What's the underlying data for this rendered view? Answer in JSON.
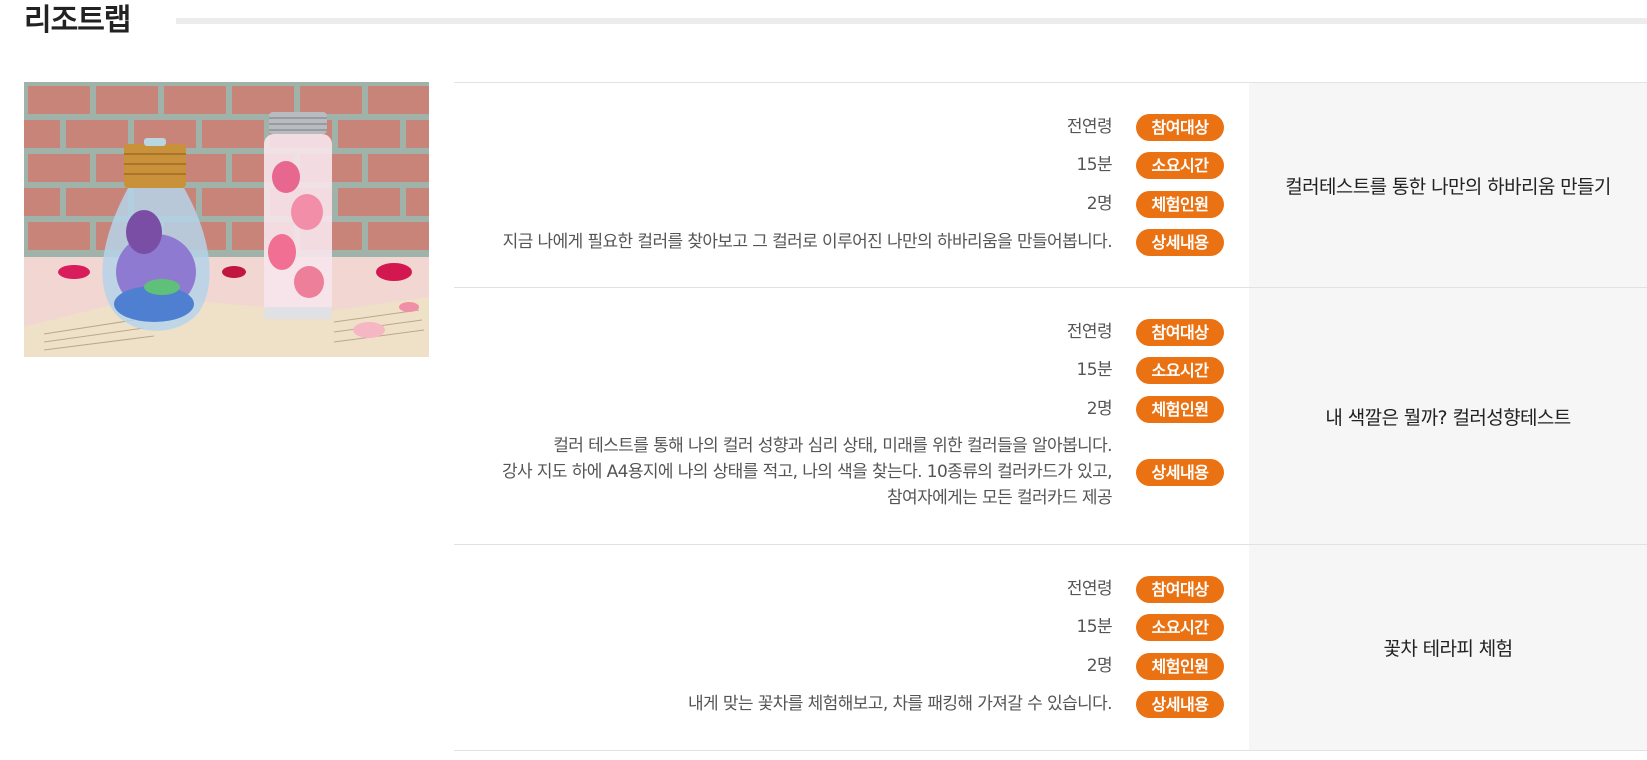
{
  "section": {
    "title": "리조트랩"
  },
  "labels": {
    "target": "참여대상",
    "duration": "소요시간",
    "people": "체험인원",
    "detail": "상세내용"
  },
  "programs": [
    {
      "title": "컬러테스트를 통한 나만의 하바리움 만들기",
      "target": "전연령",
      "duration": "15분",
      "people": "2명",
      "detail_lines": [
        "지금 나에게 필요한 컬러를 찾아보고 그 컬러로 이루어진 나만의 하바리움을 만들어봅니다."
      ]
    },
    {
      "title": "내 색깔은 뭘까? 컬러성향테스트",
      "target": "전연령",
      "duration": "15분",
      "people": "2명",
      "detail_lines": [
        "컬러 테스트를 통해 나의 컬러 성향과 심리 상태, 미래를 위한 컬러들을 알아봅니다.",
        "강사 지도 하에 A4용지에 나의 상태를 적고, 나의 색을 찾는다. 10종류의 컬러카드가 있고,",
        "참여자에게는 모든 컬러카드 제공"
      ]
    },
    {
      "title": "꽃차 테라피 체험",
      "target": "전연령",
      "duration": "15분",
      "people": "2명",
      "detail_lines": [
        "내게 맞는 꽃차를 체험해보고, 차를 패킹해 가져갈 수 있습니다."
      ]
    }
  ],
  "colors": {
    "accent": "#ea7213",
    "panel": "#f6f6f6"
  }
}
